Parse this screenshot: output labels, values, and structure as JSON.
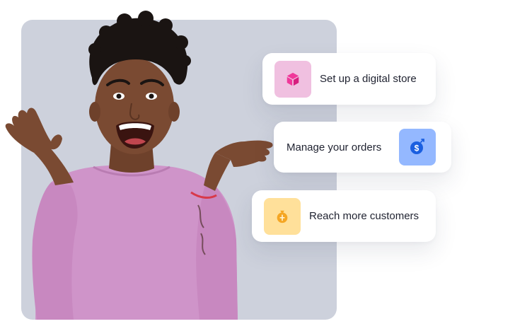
{
  "features": {
    "store": {
      "label": "Set up a digital store",
      "icon": "cube-icon",
      "icon_bg": "#f0c0e0",
      "icon_color": "#f0389a"
    },
    "orders": {
      "label": "Manage your orders",
      "icon": "dollar-coin-icon",
      "icon_bg": "#94b8ff",
      "icon_color": "#1a5fe0"
    },
    "customers": {
      "label": "Reach more customers",
      "icon": "money-bag-icon",
      "icon_bg": "#ffe09a",
      "icon_color": "#f5a623"
    }
  },
  "colors": {
    "photo_background": "#cdd1dc",
    "shirt": "#cf94c9",
    "skin": "#7a4a32",
    "hair": "#1a1412"
  }
}
